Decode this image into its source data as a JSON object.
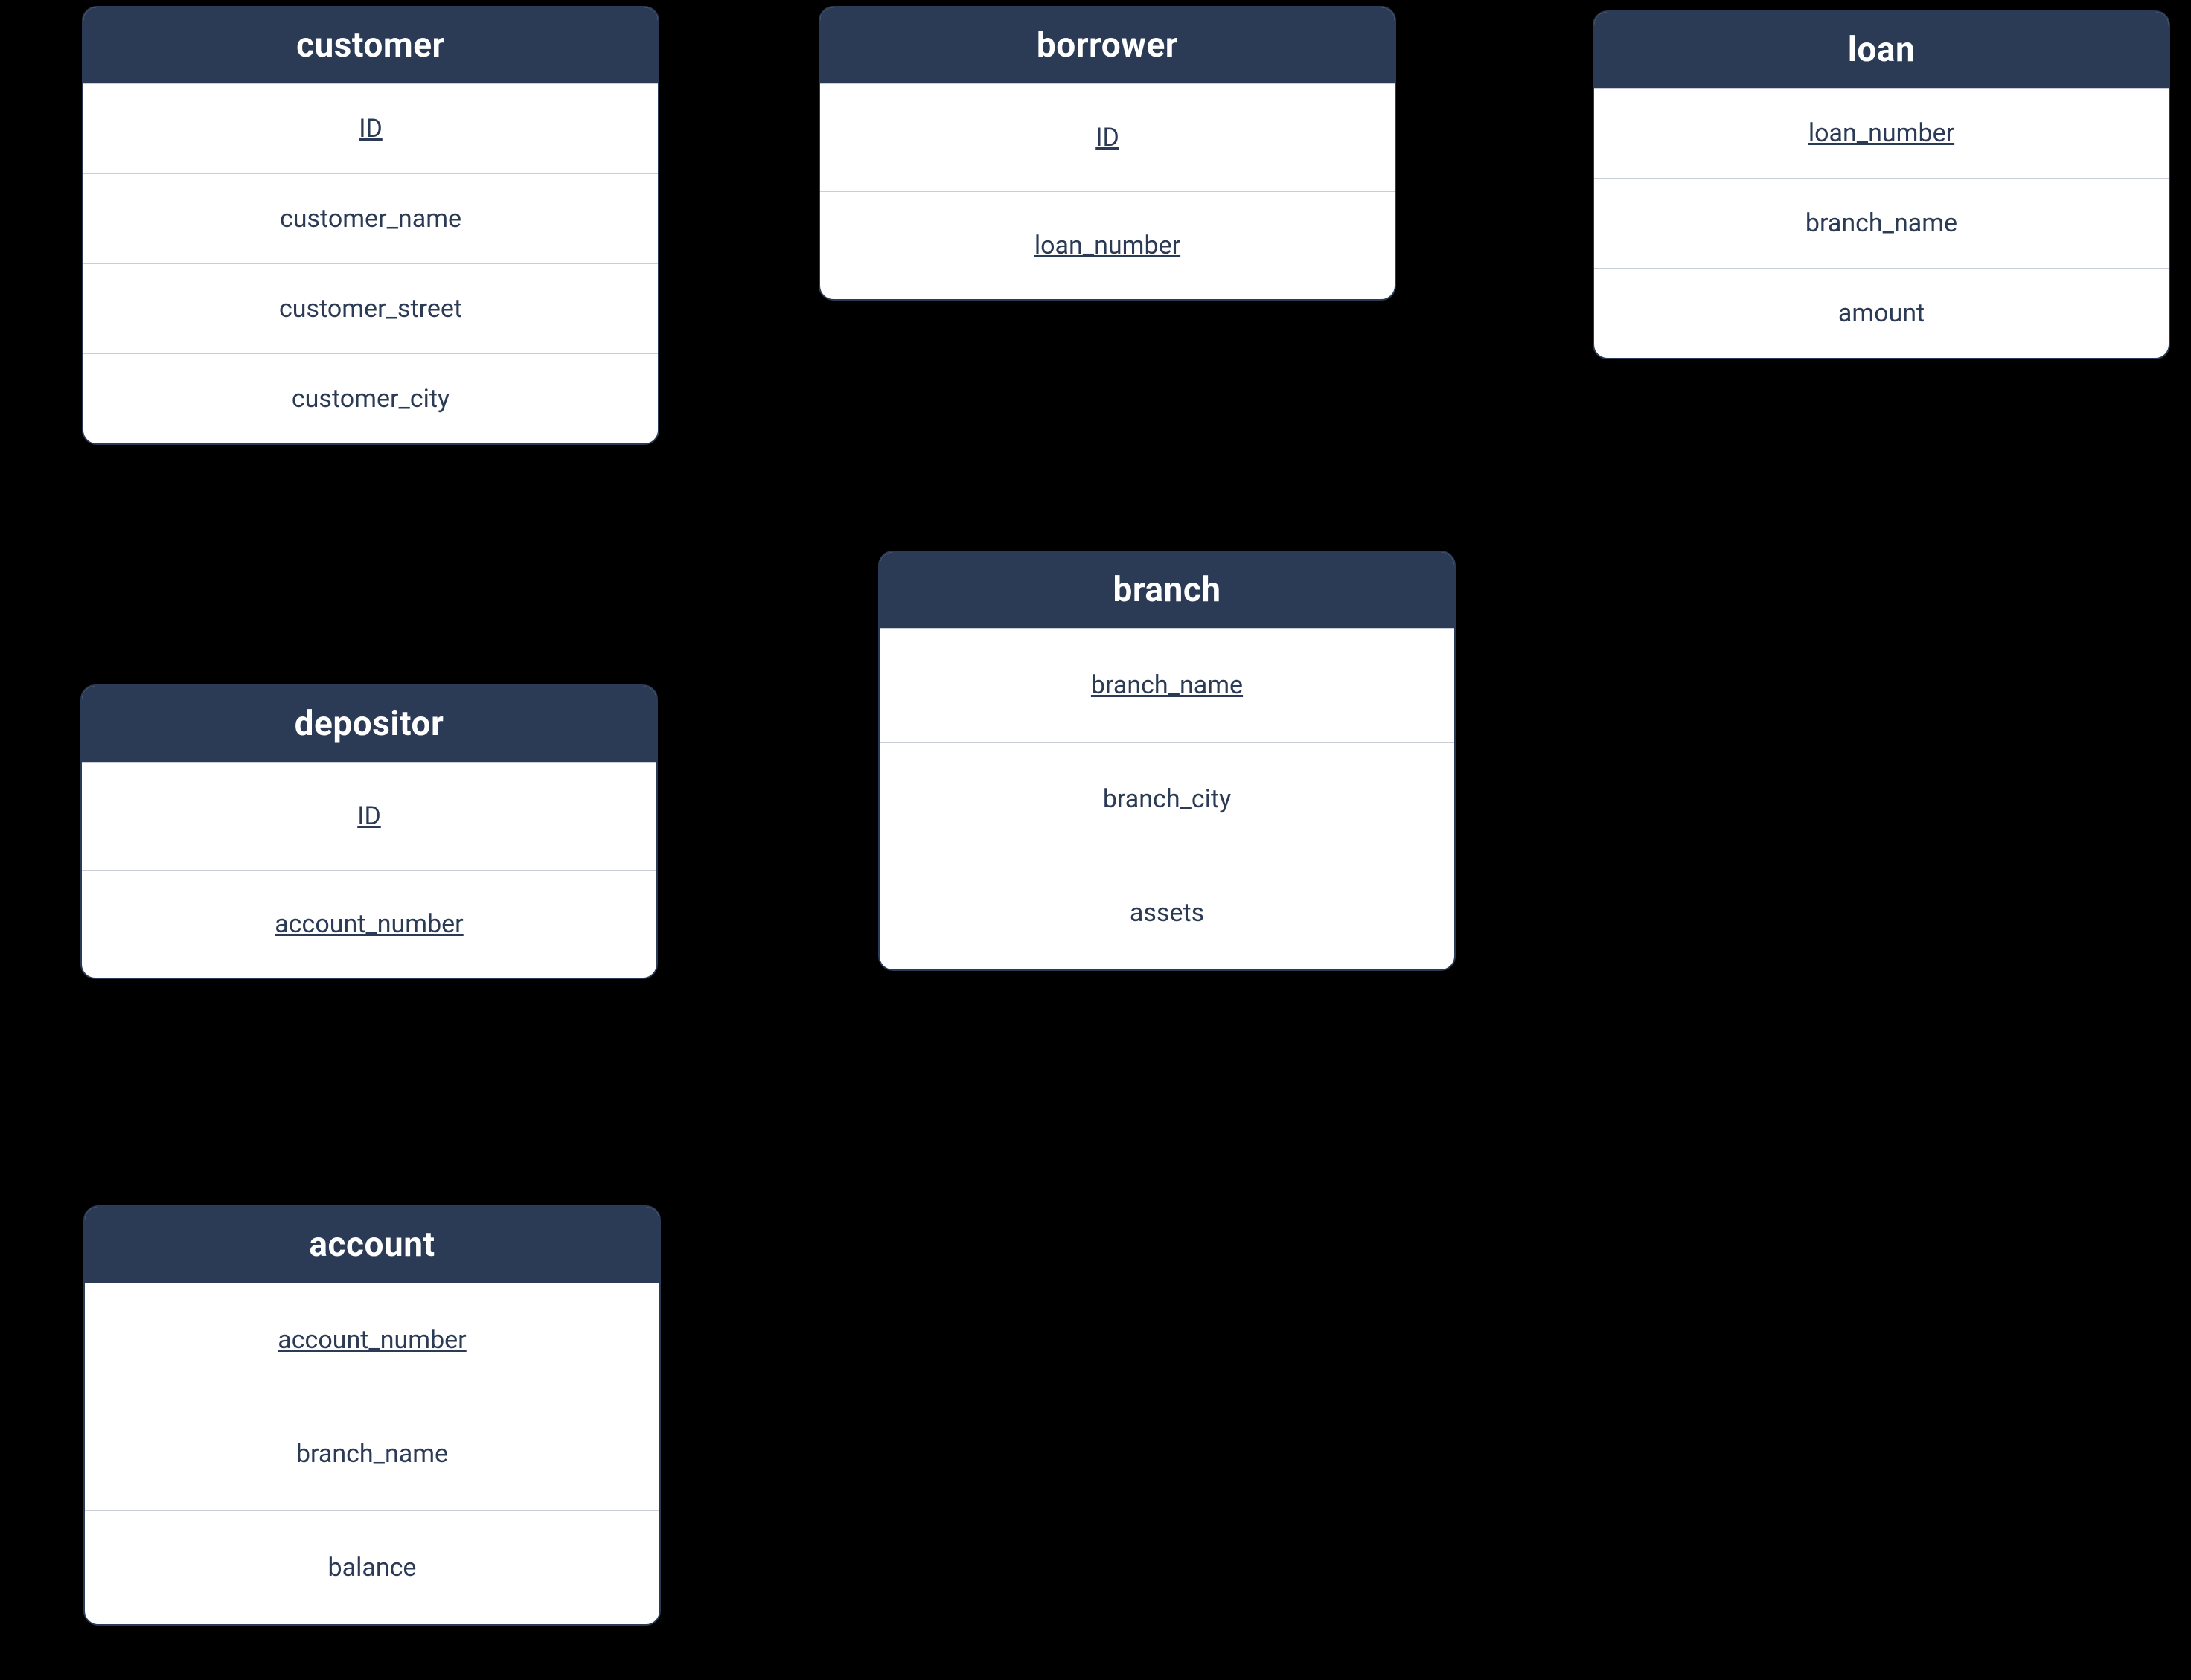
{
  "entities": {
    "customer": {
      "title": "customer",
      "rows": [
        {
          "label": "ID",
          "key": true
        },
        {
          "label": "customer_name",
          "key": false
        },
        {
          "label": "customer_street",
          "key": false
        },
        {
          "label": "customer_city",
          "key": false
        }
      ]
    },
    "borrower": {
      "title": "borrower",
      "rows": [
        {
          "label": "ID",
          "key": true
        },
        {
          "label": "loan_number",
          "key": true
        }
      ]
    },
    "loan": {
      "title": "loan",
      "rows": [
        {
          "label": "loan_number",
          "key": true
        },
        {
          "label": "branch_name",
          "key": false
        },
        {
          "label": "amount",
          "key": false
        }
      ]
    },
    "depositor": {
      "title": "depositor",
      "rows": [
        {
          "label": "ID",
          "key": true
        },
        {
          "label": "account_number",
          "key": true
        }
      ]
    },
    "branch": {
      "title": "branch",
      "rows": [
        {
          "label": "branch_name",
          "key": true
        },
        {
          "label": "branch_city",
          "key": false
        },
        {
          "label": "assets",
          "key": false
        }
      ]
    },
    "account": {
      "title": "account",
      "rows": [
        {
          "label": "account_number",
          "key": true
        },
        {
          "label": "branch_name",
          "key": false
        },
        {
          "label": "balance",
          "key": false
        }
      ]
    }
  }
}
